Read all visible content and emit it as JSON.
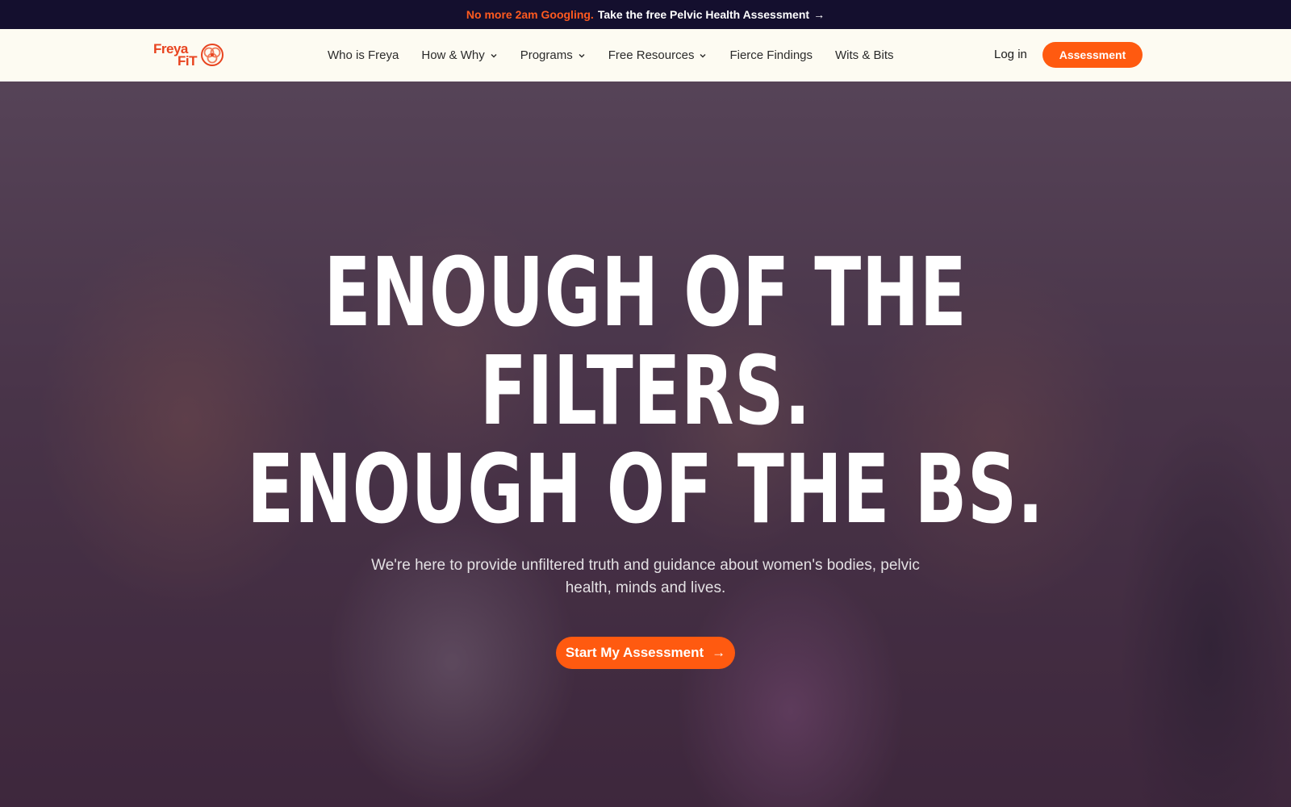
{
  "announcement": {
    "highlight": "No more 2am Googling.",
    "link_text": "Take the free Pelvic Health Assessment",
    "arrow": "→"
  },
  "header": {
    "logo_line1": "Freya",
    "logo_line2": "FiT",
    "nav": [
      {
        "label": "Who is Freya",
        "dropdown": false
      },
      {
        "label": "How & Why",
        "dropdown": true
      },
      {
        "label": "Programs",
        "dropdown": true
      },
      {
        "label": "Free Resources",
        "dropdown": true
      },
      {
        "label": "Fierce Findings",
        "dropdown": false
      },
      {
        "label": "Wits & Bits",
        "dropdown": false
      }
    ],
    "login_label": "Log in",
    "assessment_label": "Assessment"
  },
  "hero": {
    "headline_line1": "ENOUGH OF THE",
    "headline_line2": "FILTERS.",
    "headline_line3": "ENOUGH OF THE BS.",
    "subtitle": "We're here to provide unfiltered truth and guidance about women's bodies, pelvic health, minds and lives.",
    "cta_label": "Start My Assessment",
    "cta_arrow": "→"
  },
  "colors": {
    "accent": "#ff5a10",
    "announce_bg": "#140f2e",
    "header_bg": "#fdfbf2"
  },
  "icons": [
    "arrow-right-icon",
    "chevron-down-icon",
    "spiral-logo-icon"
  ]
}
